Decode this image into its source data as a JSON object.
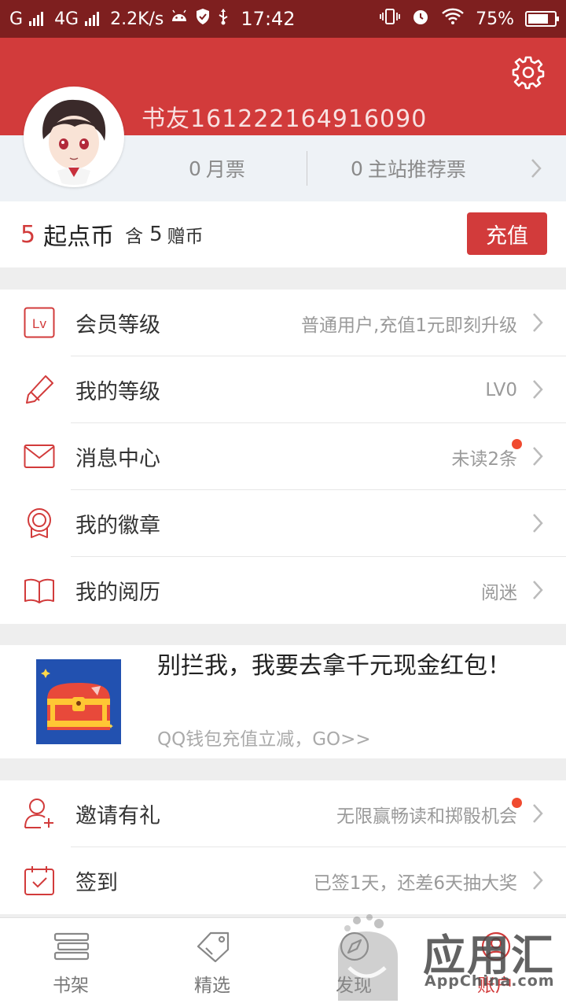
{
  "status_bar": {
    "carrier": "G",
    "network": "4G",
    "speed": "2.2K/s",
    "time": "17:42",
    "battery": "75%"
  },
  "profile": {
    "name": "书友161222164916090",
    "monthly_ticket_count": "0",
    "monthly_ticket_label": "月票",
    "recommend_ticket_count": "0",
    "recommend_ticket_label": "主站推荐票"
  },
  "coins": {
    "amount": "5",
    "unit": "起点币",
    "gift_prefix": "含",
    "gift_amount": "5",
    "gift_unit": "赠币",
    "recharge_label": "充值"
  },
  "menu_primary": [
    {
      "icon": "lv-badge-icon",
      "label": "会员等级",
      "value": "普通用户,充值1元即刻升级",
      "dot": false
    },
    {
      "icon": "pen-icon",
      "label": "我的等级",
      "value": "LV0",
      "dot": false
    },
    {
      "icon": "mail-icon",
      "label": "消息中心",
      "value": "未读2条",
      "dot": true
    },
    {
      "icon": "medal-icon",
      "label": "我的徽章",
      "value": "",
      "dot": false
    },
    {
      "icon": "book-icon",
      "label": "我的阅历",
      "value": "阅迷",
      "dot": false
    }
  ],
  "promo": {
    "title": "别拦我，我要去拿千元现金红包！",
    "subtitle": "QQ钱包充值立减，GO>>",
    "image": "treasure-chest"
  },
  "menu_secondary": [
    {
      "icon": "invite-user-icon",
      "label": "邀请有礼",
      "value": "无限赢畅读和掷骰机会",
      "dot": true
    },
    {
      "icon": "calendar-check-icon",
      "label": "签到",
      "value": "已签1天，还差6天抽大奖",
      "dot": false
    }
  ],
  "bottom_nav": [
    {
      "icon": "bookshelf-icon",
      "label": "书架",
      "active": false
    },
    {
      "icon": "tag-icon",
      "label": "精选",
      "active": false
    },
    {
      "icon": "compass-icon",
      "label": "发现",
      "active": false
    },
    {
      "icon": "account-icon",
      "label": "账户",
      "active": true
    }
  ],
  "watermark": {
    "text": "应用汇",
    "url": "AppChina.com"
  },
  "colors": {
    "brand": "#d23b3b",
    "status_bar": "#7e1f1f",
    "badge": "#f04a2f"
  }
}
